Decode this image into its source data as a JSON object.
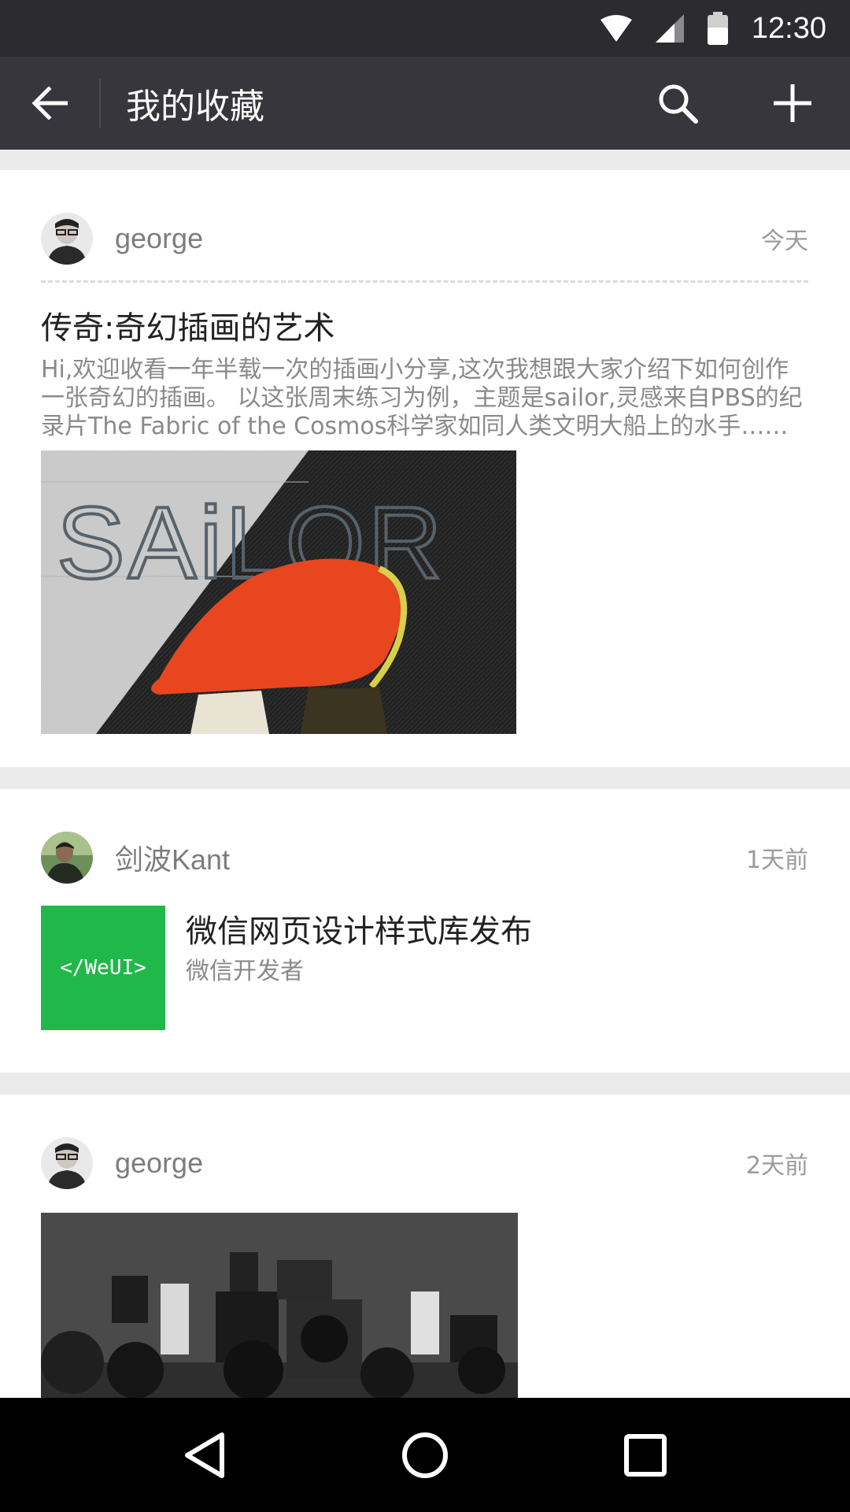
{
  "status_bar": {
    "time": "12:30"
  },
  "app_bar": {
    "title": "我的收藏"
  },
  "items": [
    {
      "user": "george",
      "time": "今天",
      "title": "传奇:奇幻插画的艺术",
      "description": "Hi,欢迎收看一年半载一次的插画小分享,这次我想跟大家介绍下如何创作一张奇幻的插画。 以这张周末练习为例，主题是sailor,灵感来自PBS的纪录片The Fabric of the Cosmos科学家如同人类文明大船上的水手……",
      "image_text": "SAiLOR"
    },
    {
      "user": "剑波Kant",
      "time": "1天前",
      "thumb_text": "</WeUI>",
      "title": "微信网页设计样式库发布",
      "source": "微信开发者"
    },
    {
      "user": "george",
      "time": "2天前"
    }
  ]
}
